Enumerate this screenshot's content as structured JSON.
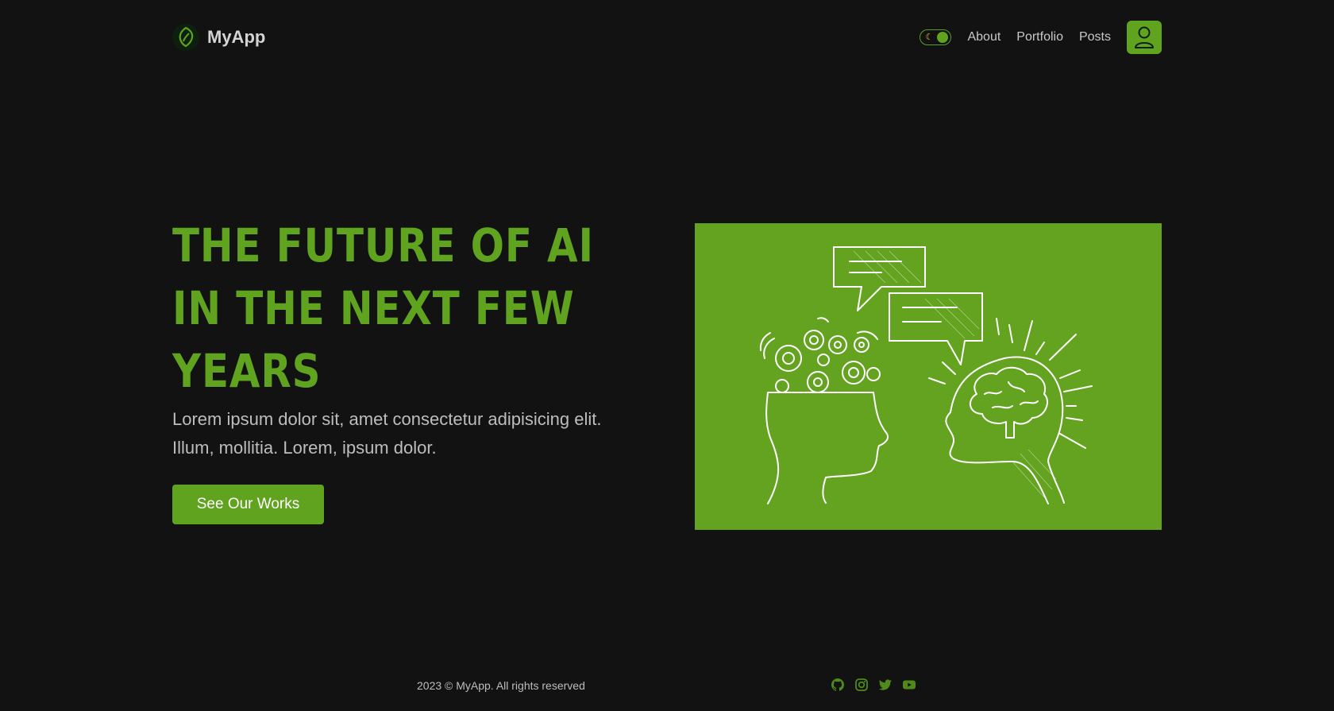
{
  "header": {
    "brand_name": "MyApp",
    "nav": [
      {
        "label": "About"
      },
      {
        "label": "Portfolio"
      },
      {
        "label": "Posts"
      }
    ]
  },
  "hero": {
    "title_lines": [
      "THE FUTURE OF AI",
      "IN THE NEXT FEW",
      "YEARS"
    ],
    "description": "Lorem ipsum dolor sit, amet consectetur adipisicing elit. Illum, mollitia. Lorem, ipsum dolor.",
    "cta_label": "See Our Works"
  },
  "footer": {
    "copyright": "2023 © MyApp. All rights reserved",
    "social": [
      "github-icon",
      "instagram-icon",
      "twitter-icon",
      "youtube-icon"
    ]
  },
  "theme": {
    "background": "#121212",
    "accent": "#5fa31f",
    "text": "#c8c8c8"
  }
}
